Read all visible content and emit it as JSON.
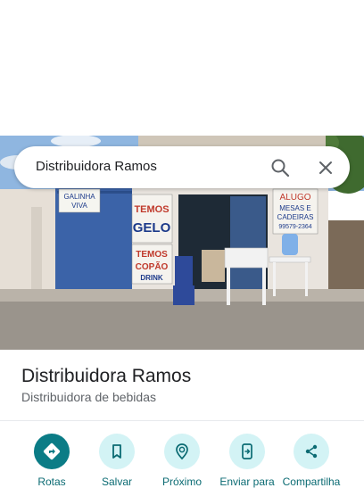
{
  "search": {
    "query": "Distribuidora Ramos"
  },
  "photo": {
    "signs": {
      "galinha": [
        "GALINHA",
        "VIVA"
      ],
      "temos_gelo": [
        "TEMOS",
        "GELO"
      ],
      "temos_copao": [
        "TEMOS",
        "COPÃO",
        "DRINK"
      ],
      "aluga": [
        "ALUGO",
        "MESAS E",
        "CADEIRAS",
        "99579-2364"
      ]
    }
  },
  "place": {
    "name": "Distribuidora Ramos",
    "category": "Distribuidora de bebidas"
  },
  "actions": [
    {
      "label": "Rotas",
      "icon": "directions-icon"
    },
    {
      "label": "Salvar",
      "icon": "bookmark-icon"
    },
    {
      "label": "Próximo",
      "icon": "nearby-icon"
    },
    {
      "label": "Enviar para",
      "icon": "send-to-phone-icon"
    },
    {
      "label": "Compartilha",
      "icon": "share-icon"
    }
  ],
  "colors": {
    "accent": "#0b7c86",
    "action_bg": "#d3f3f5",
    "action_text": "#0b6b73"
  }
}
